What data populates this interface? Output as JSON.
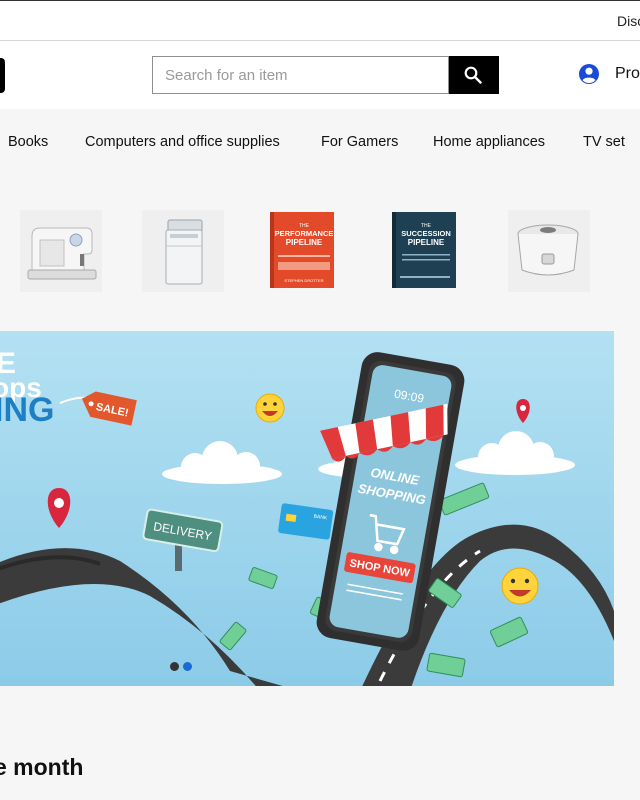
{
  "topbar": {
    "text": "Disc"
  },
  "search": {
    "placeholder": "Search for an item"
  },
  "profile": {
    "label": "Pro"
  },
  "nav": {
    "items": [
      "Books",
      "Computers and office supplies",
      "For Gamers",
      "Home appliances",
      "TV set"
    ]
  },
  "thumbnails": [
    "sewing-machine",
    "washing-machine",
    "book-the-performance-pipeline",
    "book-the-succession-pipeline",
    "rice-cooker"
  ],
  "books": {
    "performance": {
      "title_top": "THE",
      "title1": "PERFORMANCE",
      "title2": "PIPELINE",
      "author": "STEPHEN DROTTER"
    },
    "succession": {
      "title_top": "THE",
      "title1": "SUCCESSION",
      "title2": "PIPELINE"
    }
  },
  "banner": {
    "headline_partial1": "E",
    "headline_partial2": "ops",
    "headline_partial3": "ING",
    "tag": "SALE!",
    "sign": "DELIVERY",
    "phone_time": "09:09",
    "phone_line1": "ONLINE",
    "phone_line2": "SHOPPING",
    "cta": "SHOP NOW",
    "card_label": "BANK",
    "carousel_dots": 2,
    "active_dot": 2
  },
  "section": {
    "title": "e month"
  },
  "colors": {
    "accent": "#1a4bd6",
    "search_button": "#000000",
    "banner_sky": "#a9dcf0",
    "sale_tag": "#e2572b",
    "cta": "#e8443a"
  }
}
